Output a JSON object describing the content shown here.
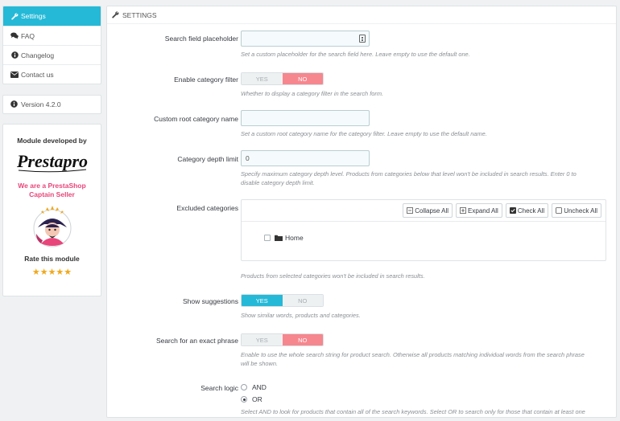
{
  "sidebar": {
    "menu": [
      {
        "label": "Settings",
        "icon": "wrench-icon",
        "active": true
      },
      {
        "label": "FAQ",
        "icon": "chat-icon",
        "active": false
      },
      {
        "label": "Changelog",
        "icon": "info-icon",
        "active": false
      },
      {
        "label": "Contact us",
        "icon": "envelope-icon",
        "active": false
      }
    ],
    "version": "Version 4.2.0",
    "promo": {
      "developed_by": "Module developed by",
      "logo_text": "Prestapro",
      "captain_line1": "We are a PrestaShop",
      "captain_line2": "Captain Seller",
      "rate": "Rate this module",
      "stars": "★★★★★"
    }
  },
  "panel": {
    "title": "Settings",
    "fields": {
      "search_placeholder": {
        "label": "Search field placeholder",
        "value": "",
        "help": "Set a custom placeholder for the search field here. Leave empty to use the default one."
      },
      "category_filter": {
        "label": "Enable category filter",
        "yes": "YES",
        "no": "NO",
        "selected": "NO",
        "help": "Whether to display a category filter in the search form."
      },
      "root_category": {
        "label": "Custom root category name",
        "value": "",
        "help": "Set a custom root category name for the category filter. Leave empty to use the default name."
      },
      "depth_limit": {
        "label": "Category depth limit",
        "value": "0",
        "help_line1": "Specify maximum category depth level. Products from categories below that level won't be included in search results. Enter 0 to",
        "help_line2": "disable category depth limit."
      },
      "excluded": {
        "label": "Excluded categories",
        "collapse": "Collapse All",
        "expand": "Expand All",
        "check": "Check All",
        "uncheck": "Uncheck All",
        "node": "Home",
        "help": "Products from selected categories won't be included in search results."
      },
      "suggestions": {
        "label": "Show suggestions",
        "yes": "YES",
        "no": "NO",
        "selected": "YES",
        "help": "Show similar words, products and categories."
      },
      "exact_phrase": {
        "label": "Search for an exact phrase",
        "yes": "YES",
        "no": "NO",
        "selected": "NO",
        "help_line1": "Enable to use the whole search string for product search. Otherwise all products matching individual words from the search phrase",
        "help_line2": "will be shown."
      },
      "search_logic": {
        "label": "Search logic",
        "options": [
          "AND",
          "OR"
        ],
        "selected": "OR",
        "help": "Select AND to look for products that contain all of the search keywords. Select OR to search only for those that contain at least one"
      }
    }
  },
  "colors": {
    "accent": "#25b9d7",
    "no_active": "#f6878e",
    "star": "#f0a81c",
    "captain": "#e8457a"
  }
}
